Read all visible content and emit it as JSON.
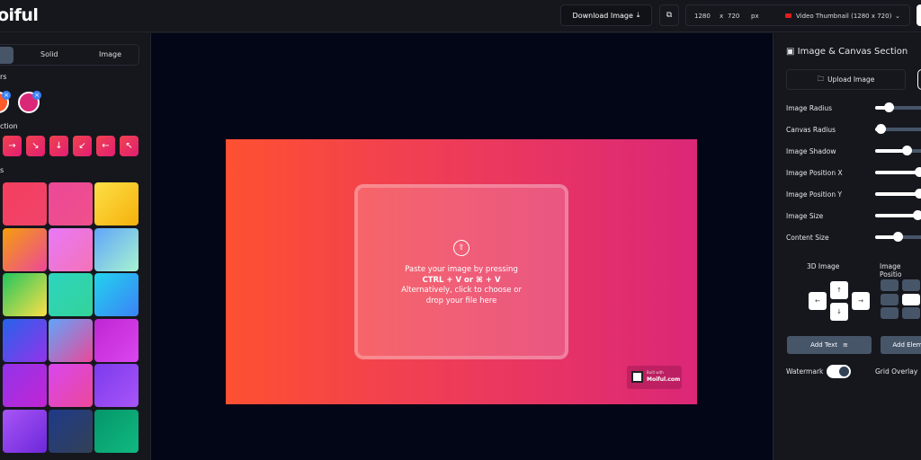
{
  "header": {
    "logo": "oiful",
    "download_label": "Download Image",
    "download_icon": "download-icon",
    "copy_icon": "copy-icon",
    "width": "1280",
    "x": "x",
    "height": "720",
    "unit": "px",
    "preset": "Video Thumbnail (1280 x 720)"
  },
  "left": {
    "tabs": [
      "Solid",
      "Image"
    ],
    "colors_label": "rs",
    "colors": [
      "#ff5a2a",
      "#db2777"
    ],
    "direction_label": "ction",
    "directions": [
      "→",
      "↘",
      "↓",
      "↙",
      "←",
      "↖"
    ],
    "presets_label": "s",
    "swatches": [
      [
        "#f43f5e",
        "#f0436b"
      ],
      [
        "#ec4899",
        "#f0508a"
      ],
      [
        "#fde047",
        "#f5b00b"
      ],
      [
        "#f59e0b",
        "#ec4899"
      ],
      [
        "#e879f9",
        "#f472b6"
      ],
      [
        "#60a5fa",
        "#a7f3d0"
      ],
      [
        "#22c55e",
        "#fde047"
      ],
      [
        "#2dd4bf",
        "#34d399"
      ],
      [
        "#22d3ee",
        "#3b82f6"
      ],
      [
        "#2563eb",
        "#9333ea"
      ],
      [
        "#60a5fa",
        "#ec4899"
      ],
      [
        "#c026d3",
        "#d946ef"
      ],
      [
        "#9333ea",
        "#c026d3"
      ],
      [
        "#d946ef",
        "#ec4899"
      ],
      [
        "#7c3aed",
        "#a855f7"
      ],
      [
        "#a855f7",
        "#6d28d9"
      ],
      [
        "#1e3a8a",
        "#334155"
      ],
      [
        "#059669",
        "#10b981"
      ]
    ]
  },
  "canvas": {
    "drop_line1": "Paste your image by pressing",
    "drop_line2": "CTRL + V or ⌘ + V",
    "drop_line3": "Alternatively, click to choose or",
    "drop_line4": "drop your file here",
    "wm_small": "Built with",
    "wm_big": "Moiful.com"
  },
  "right": {
    "section_title": "Image & Canvas Section",
    "upload_label": "Upload Image",
    "sliders": [
      {
        "label": "Image Radius",
        "value": 0.25
      },
      {
        "label": "Canvas Radius",
        "value": 0.1
      },
      {
        "label": "Image Shadow",
        "value": 0.58
      },
      {
        "label": "Image Position X",
        "value": 0.82
      },
      {
        "label": "Image Position Y",
        "value": 0.82
      },
      {
        "label": "Image Size",
        "value": 0.78
      },
      {
        "label": "Content Size",
        "value": 0.42
      }
    ],
    "three_d_label": "3D Image",
    "position_label": "Image Positio",
    "add_text": "Add Text",
    "add_element": "Add Elem",
    "watermark_label": "Watermark",
    "watermark_on": true,
    "grid_label": "Grid Overlay"
  }
}
